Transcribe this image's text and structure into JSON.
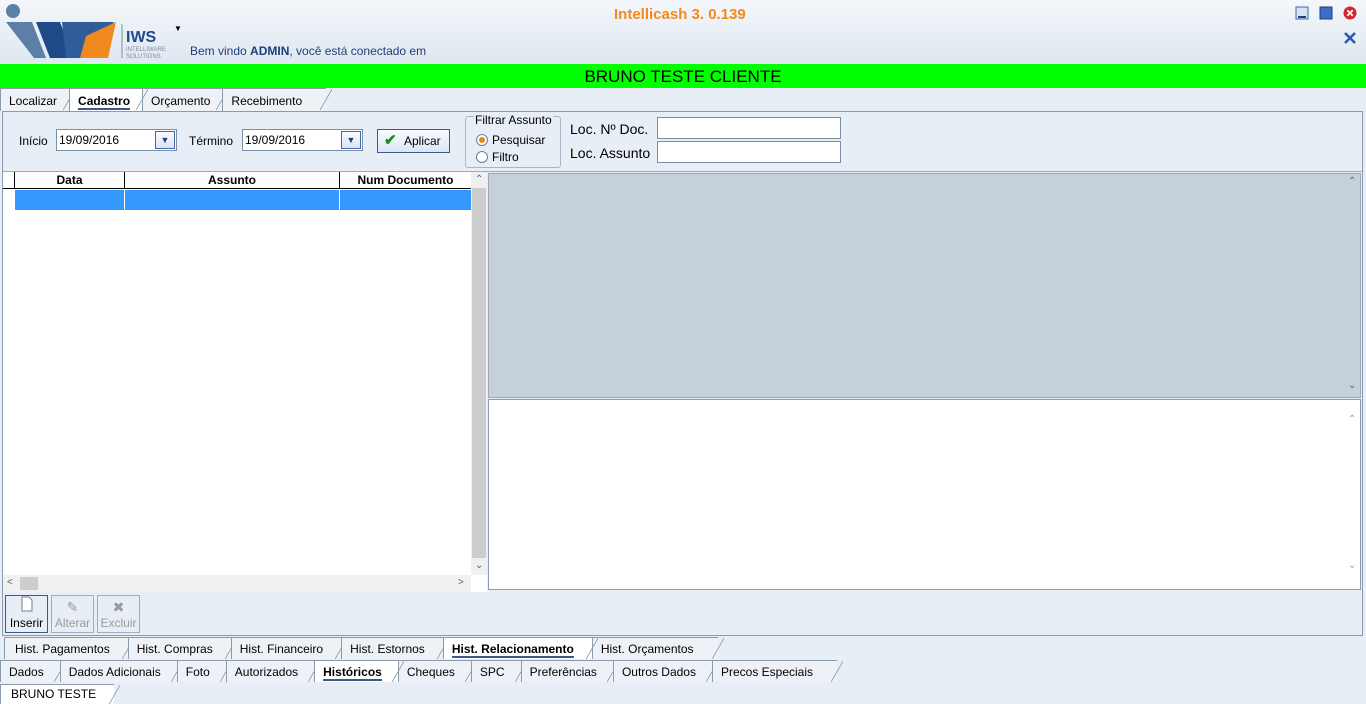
{
  "app": {
    "title": "Intellicash 3. 0.139",
    "logo_text": "IWS",
    "logo_subtext_1": "INTELLIWARE",
    "logo_subtext_2": "SOLUTIONS",
    "welcome_prefix": "Bem vindo ",
    "welcome_user": "ADMIN",
    "welcome_suffix": ", você está conectado em"
  },
  "customer_name": "BRUNO TESTE CLIENTE",
  "top_tabs": [
    {
      "label": "Localizar",
      "active": false
    },
    {
      "label": "Cadastro",
      "active": true
    },
    {
      "label": "Orçamento",
      "active": false
    },
    {
      "label": "Recebimento",
      "active": false
    }
  ],
  "filters": {
    "start_label": "Início",
    "start_value": "19/09/2016",
    "end_label": "Término",
    "end_value": "19/09/2016",
    "apply_label": "Aplicar",
    "group_label": "Filtrar Assunto",
    "radio_search": "Pesquisar",
    "radio_filter": "Filtro",
    "selected": "Pesquisar",
    "doc_label": "Loc. Nº Doc.",
    "doc_value": "",
    "subject_label": "Loc. Assunto",
    "subject_value": ""
  },
  "grid": {
    "columns": [
      "Data",
      "Assunto",
      "Num Documento"
    ],
    "rows": [
      [
        "",
        "",
        ""
      ]
    ]
  },
  "actions": {
    "insert": "Inserir",
    "edit": "Alterar",
    "delete": "Excluir"
  },
  "history_tabs": [
    {
      "label": "Hist. Pagamentos",
      "active": false
    },
    {
      "label": "Hist. Compras",
      "active": false
    },
    {
      "label": "Hist. Financeiro",
      "active": false
    },
    {
      "label": "Hist. Estornos",
      "active": false
    },
    {
      "label": "Hist. Relacionamento",
      "active": true
    },
    {
      "label": "Hist. Orçamentos",
      "active": false
    }
  ],
  "bottom_tabs": [
    {
      "label": "Dados",
      "active": false
    },
    {
      "label": "Dados Adicionais",
      "active": false
    },
    {
      "label": "Foto",
      "active": false
    },
    {
      "label": "Autorizados",
      "active": false
    },
    {
      "label": "Históricos",
      "active": true
    },
    {
      "label": "Cheques",
      "active": false
    },
    {
      "label": "SPC",
      "active": false
    },
    {
      "label": "Preferências",
      "active": false
    },
    {
      "label": "Outros Dados",
      "active": false
    },
    {
      "label": "Precos Especiais",
      "active": false
    }
  ],
  "status_tabs": [
    {
      "label": "BRUNO TESTE",
      "active": false
    }
  ],
  "colors": {
    "title": "#f08a1e",
    "customer_bar": "#00ff00",
    "selection": "#3399ff"
  }
}
